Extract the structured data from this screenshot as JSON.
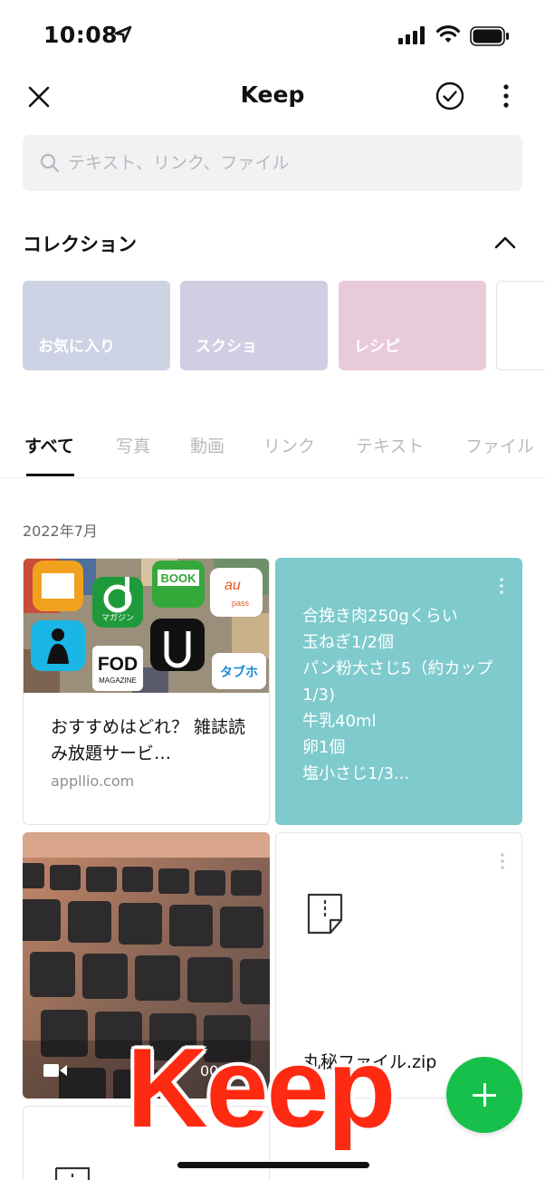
{
  "status_bar": {
    "time": "10:08"
  },
  "header": {
    "title": "Keep"
  },
  "search": {
    "placeholder": "テキスト、リンク、ファイル"
  },
  "collections": {
    "heading": "コレクション",
    "items": [
      {
        "label": "お気に入り",
        "color": "#cdd3e4"
      },
      {
        "label": "スクショ",
        "color": "#d2cde3"
      },
      {
        "label": "レシピ",
        "color": "#e9cadb"
      }
    ]
  },
  "tabs": [
    {
      "label": "すべて",
      "active": true
    },
    {
      "label": "写真",
      "active": false
    },
    {
      "label": "動画",
      "active": false
    },
    {
      "label": "リンク",
      "active": false
    },
    {
      "label": "テキスト",
      "active": false
    },
    {
      "label": "ファイル",
      "active": false
    }
  ],
  "content": {
    "date_heading": "2022年7月",
    "link_card": {
      "title": "おすすめはどれ？ 雑誌読み放題サービ…",
      "domain": "appllio.com",
      "thumb_labels": [
        "マガジン",
        "BOOK",
        "au",
        "pass",
        "FOD",
        "MAGAZINE",
        "タブホ"
      ]
    },
    "memo_card": {
      "text": "合挽き肉250gくらい\n玉ねぎ1/2個\nパン粉大さじ5（約カップ1/3)\n牛乳40ml\n卵1個\n塩小さじ1/3...",
      "color": "#7ecacd"
    },
    "video_card": {
      "duration": "00:03"
    },
    "file_card": {
      "name": "丸秘ファイル.zip"
    }
  },
  "overlay": {
    "logo_text": "Keep"
  },
  "colors": {
    "accent": "#17c04b",
    "overlay_red": "#ff2a12"
  }
}
